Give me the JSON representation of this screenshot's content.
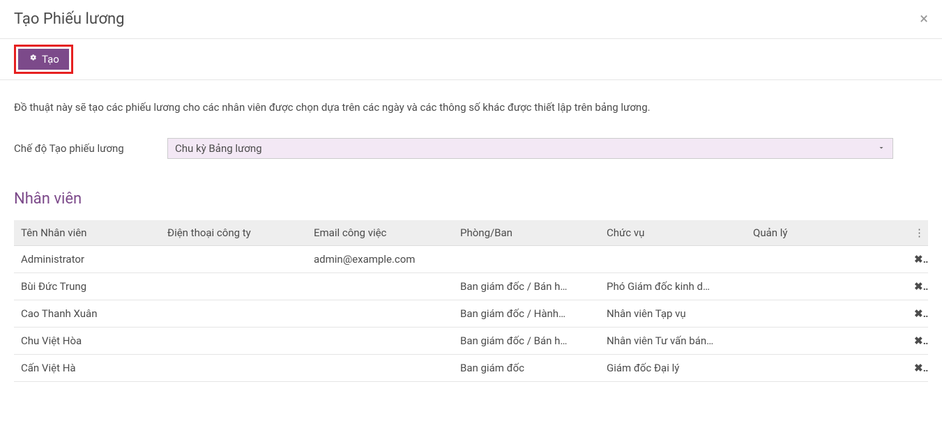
{
  "modal": {
    "title": "Tạo Phiếu lương"
  },
  "toolbar": {
    "create_label": "Tạo"
  },
  "description": "Đồ thuật này sẽ tạo các phiếu lương cho các nhân viên được chọn dựa trên các ngày và các thông số khác được thiết lập trên bảng lương.",
  "field": {
    "mode_label": "Chế độ Tạo phiếu lương",
    "mode_value": "Chu kỳ Bảng lương"
  },
  "section": {
    "employees_title": "Nhân viên"
  },
  "table": {
    "headers": {
      "name": "Tên Nhân viên",
      "phone": "Điện thoại công ty",
      "email": "Email công việc",
      "department": "Phòng/Ban",
      "position": "Chức vụ",
      "manager": "Quản lý"
    },
    "rows": [
      {
        "name": "Administrator",
        "phone": "",
        "email": "admin@example.com",
        "department": "",
        "position": "",
        "manager": ""
      },
      {
        "name": "Bùi Đức Trung",
        "phone": "",
        "email": "",
        "department": "Ban giám đốc / Bán h…",
        "position": "Phó Giám đốc kinh d…",
        "manager": ""
      },
      {
        "name": "Cao Thanh Xuân",
        "phone": "",
        "email": "",
        "department": "Ban giám đốc / Hành…",
        "position": "Nhân viên Tạp vụ",
        "manager": ""
      },
      {
        "name": "Chu Việt Hòa",
        "phone": "",
        "email": "",
        "department": "Ban giám đốc / Bán h…",
        "position": "Nhân viên Tư vấn bán…",
        "manager": ""
      },
      {
        "name": "Cấn Việt Hà",
        "phone": "",
        "email": "",
        "department": "Ban giám đốc",
        "position": "Giám đốc Đại lý",
        "manager": ""
      }
    ]
  }
}
